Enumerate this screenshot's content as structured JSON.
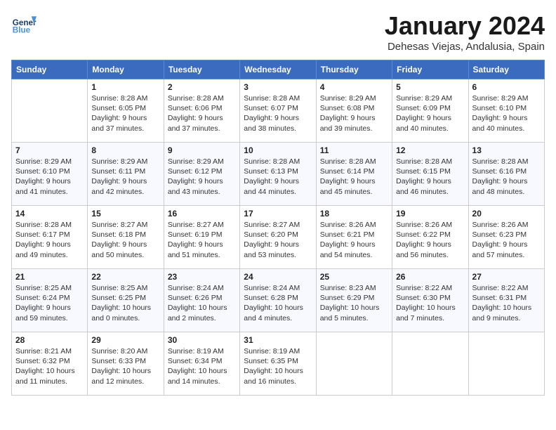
{
  "header": {
    "logo_line1": "General",
    "logo_line2": "Blue",
    "month_title": "January 2024",
    "location": "Dehesas Viejas, Andalusia, Spain"
  },
  "weekdays": [
    "Sunday",
    "Monday",
    "Tuesday",
    "Wednesday",
    "Thursday",
    "Friday",
    "Saturday"
  ],
  "weeks": [
    [
      {
        "day": "",
        "info": ""
      },
      {
        "day": "1",
        "info": "Sunrise: 8:28 AM\nSunset: 6:05 PM\nDaylight: 9 hours\nand 37 minutes."
      },
      {
        "day": "2",
        "info": "Sunrise: 8:28 AM\nSunset: 6:06 PM\nDaylight: 9 hours\nand 37 minutes."
      },
      {
        "day": "3",
        "info": "Sunrise: 8:28 AM\nSunset: 6:07 PM\nDaylight: 9 hours\nand 38 minutes."
      },
      {
        "day": "4",
        "info": "Sunrise: 8:29 AM\nSunset: 6:08 PM\nDaylight: 9 hours\nand 39 minutes."
      },
      {
        "day": "5",
        "info": "Sunrise: 8:29 AM\nSunset: 6:09 PM\nDaylight: 9 hours\nand 40 minutes."
      },
      {
        "day": "6",
        "info": "Sunrise: 8:29 AM\nSunset: 6:10 PM\nDaylight: 9 hours\nand 40 minutes."
      }
    ],
    [
      {
        "day": "7",
        "info": "Sunrise: 8:29 AM\nSunset: 6:10 PM\nDaylight: 9 hours\nand 41 minutes."
      },
      {
        "day": "8",
        "info": "Sunrise: 8:29 AM\nSunset: 6:11 PM\nDaylight: 9 hours\nand 42 minutes."
      },
      {
        "day": "9",
        "info": "Sunrise: 8:29 AM\nSunset: 6:12 PM\nDaylight: 9 hours\nand 43 minutes."
      },
      {
        "day": "10",
        "info": "Sunrise: 8:28 AM\nSunset: 6:13 PM\nDaylight: 9 hours\nand 44 minutes."
      },
      {
        "day": "11",
        "info": "Sunrise: 8:28 AM\nSunset: 6:14 PM\nDaylight: 9 hours\nand 45 minutes."
      },
      {
        "day": "12",
        "info": "Sunrise: 8:28 AM\nSunset: 6:15 PM\nDaylight: 9 hours\nand 46 minutes."
      },
      {
        "day": "13",
        "info": "Sunrise: 8:28 AM\nSunset: 6:16 PM\nDaylight: 9 hours\nand 48 minutes."
      }
    ],
    [
      {
        "day": "14",
        "info": "Sunrise: 8:28 AM\nSunset: 6:17 PM\nDaylight: 9 hours\nand 49 minutes."
      },
      {
        "day": "15",
        "info": "Sunrise: 8:27 AM\nSunset: 6:18 PM\nDaylight: 9 hours\nand 50 minutes."
      },
      {
        "day": "16",
        "info": "Sunrise: 8:27 AM\nSunset: 6:19 PM\nDaylight: 9 hours\nand 51 minutes."
      },
      {
        "day": "17",
        "info": "Sunrise: 8:27 AM\nSunset: 6:20 PM\nDaylight: 9 hours\nand 53 minutes."
      },
      {
        "day": "18",
        "info": "Sunrise: 8:26 AM\nSunset: 6:21 PM\nDaylight: 9 hours\nand 54 minutes."
      },
      {
        "day": "19",
        "info": "Sunrise: 8:26 AM\nSunset: 6:22 PM\nDaylight: 9 hours\nand 56 minutes."
      },
      {
        "day": "20",
        "info": "Sunrise: 8:26 AM\nSunset: 6:23 PM\nDaylight: 9 hours\nand 57 minutes."
      }
    ],
    [
      {
        "day": "21",
        "info": "Sunrise: 8:25 AM\nSunset: 6:24 PM\nDaylight: 9 hours\nand 59 minutes."
      },
      {
        "day": "22",
        "info": "Sunrise: 8:25 AM\nSunset: 6:25 PM\nDaylight: 10 hours\nand 0 minutes."
      },
      {
        "day": "23",
        "info": "Sunrise: 8:24 AM\nSunset: 6:26 PM\nDaylight: 10 hours\nand 2 minutes."
      },
      {
        "day": "24",
        "info": "Sunrise: 8:24 AM\nSunset: 6:28 PM\nDaylight: 10 hours\nand 4 minutes."
      },
      {
        "day": "25",
        "info": "Sunrise: 8:23 AM\nSunset: 6:29 PM\nDaylight: 10 hours\nand 5 minutes."
      },
      {
        "day": "26",
        "info": "Sunrise: 8:22 AM\nSunset: 6:30 PM\nDaylight: 10 hours\nand 7 minutes."
      },
      {
        "day": "27",
        "info": "Sunrise: 8:22 AM\nSunset: 6:31 PM\nDaylight: 10 hours\nand 9 minutes."
      }
    ],
    [
      {
        "day": "28",
        "info": "Sunrise: 8:21 AM\nSunset: 6:32 PM\nDaylight: 10 hours\nand 11 minutes."
      },
      {
        "day": "29",
        "info": "Sunrise: 8:20 AM\nSunset: 6:33 PM\nDaylight: 10 hours\nand 12 minutes."
      },
      {
        "day": "30",
        "info": "Sunrise: 8:19 AM\nSunset: 6:34 PM\nDaylight: 10 hours\nand 14 minutes."
      },
      {
        "day": "31",
        "info": "Sunrise: 8:19 AM\nSunset: 6:35 PM\nDaylight: 10 hours\nand 16 minutes."
      },
      {
        "day": "",
        "info": ""
      },
      {
        "day": "",
        "info": ""
      },
      {
        "day": "",
        "info": ""
      }
    ]
  ]
}
